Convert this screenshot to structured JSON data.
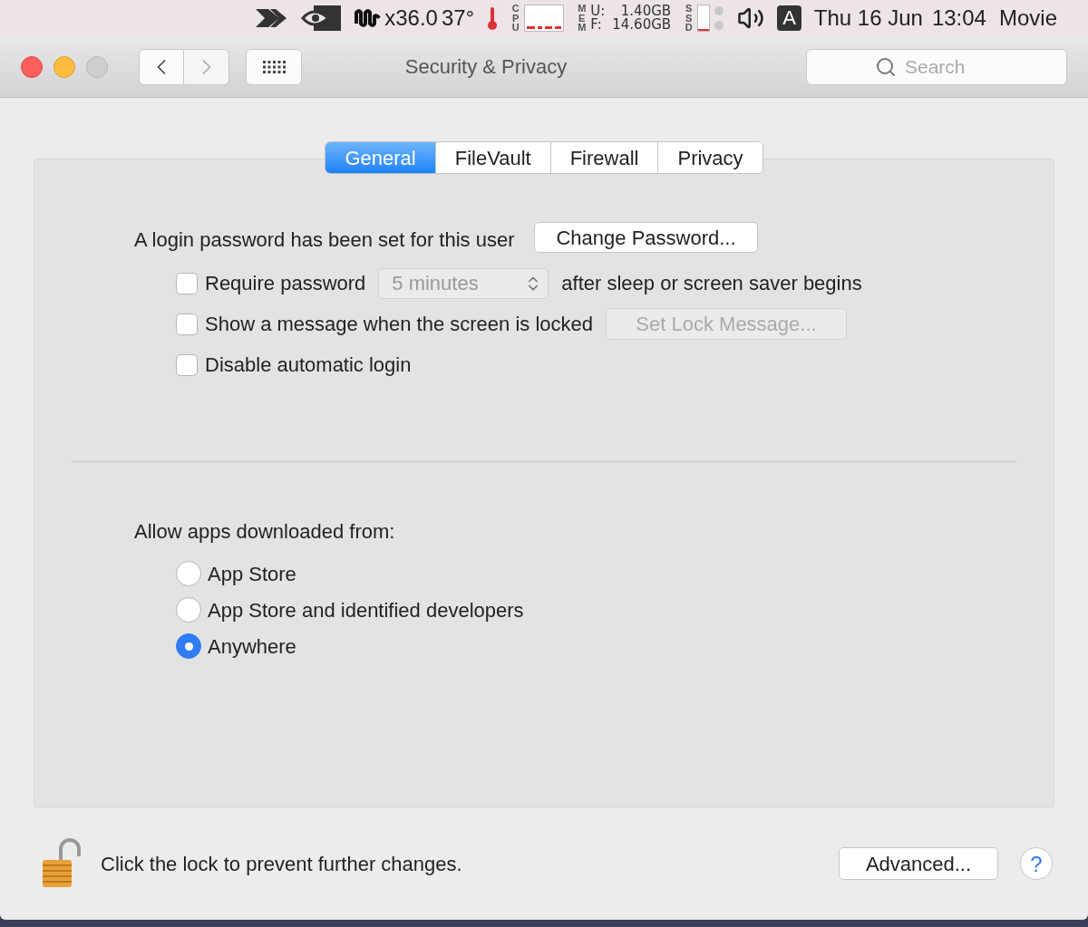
{
  "menu_bar": {
    "fan_reading": "x36.0",
    "temperature": "37°",
    "cpu_label": "CPU",
    "mem_label": "MEM",
    "mem_used_label": "U:",
    "mem_used": "1.40GB",
    "mem_free_label": "F:",
    "mem_free": "14.60GB",
    "ssd_label": "SSD",
    "input_source": "A",
    "date": "Thu 16 Jun",
    "time": "13:04",
    "app_name": "Movie"
  },
  "window": {
    "title": "Security & Privacy",
    "search": {
      "placeholder": "Search"
    }
  },
  "tabs": [
    {
      "label": "General",
      "selected": true
    },
    {
      "label": "FileVault",
      "selected": false
    },
    {
      "label": "Firewall",
      "selected": false
    },
    {
      "label": "Privacy",
      "selected": false
    }
  ],
  "password": {
    "text": "A login password has been set for this user",
    "button": "Change Password..."
  },
  "options": [
    {
      "kind": "select",
      "label": "Require password",
      "checked": false,
      "control": {
        "value": "5 minutes",
        "disabled": true
      },
      "suffix": "after sleep or screen saver begins"
    },
    {
      "kind": "button",
      "label": "Show a message when the screen is locked",
      "checked": false,
      "control": {
        "value": "Set Lock Message...",
        "disabled": true
      }
    },
    {
      "kind": "plain",
      "label": "Disable automatic login",
      "checked": false
    }
  ],
  "downloads": {
    "label": "Allow apps downloaded from:",
    "options": [
      {
        "label": "App Store",
        "selected": false
      },
      {
        "label": "App Store and identified developers",
        "selected": false
      },
      {
        "label": "Anywhere",
        "selected": true
      }
    ]
  },
  "footer": {
    "lock_text": "Click the lock to prevent further changes.",
    "advanced": "Advanced...",
    "help": "?"
  }
}
